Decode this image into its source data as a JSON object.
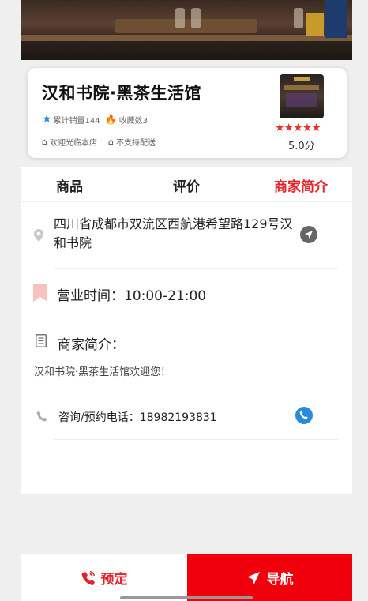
{
  "shop": {
    "name": "汉和书院·黑茶生活馆",
    "sales": "累计销量144",
    "favorites": "收藏数3",
    "tag_welcome": "欢迎光临本店",
    "tag_delivery": "不支持配送",
    "rating_stars": 5,
    "score": "5.0分"
  },
  "tabs": {
    "goods": "商品",
    "reviews": "评价",
    "intro": "商家简介"
  },
  "info": {
    "address": "四川省成都市双流区西航港希望路129号汉和书院",
    "hours": "营业时间：10:00-21:00",
    "intro_heading": "商家简介：",
    "intro_text": "汉和书院·黑茶生活馆欢迎您！",
    "phone": "咨询/预约电话：18982193831"
  },
  "actions": {
    "book": "预定",
    "navigate": "导航"
  },
  "colors": {
    "accent": "#e5222a",
    "nav_button": "#f0000c",
    "star_blue": "#2a8bd8"
  }
}
